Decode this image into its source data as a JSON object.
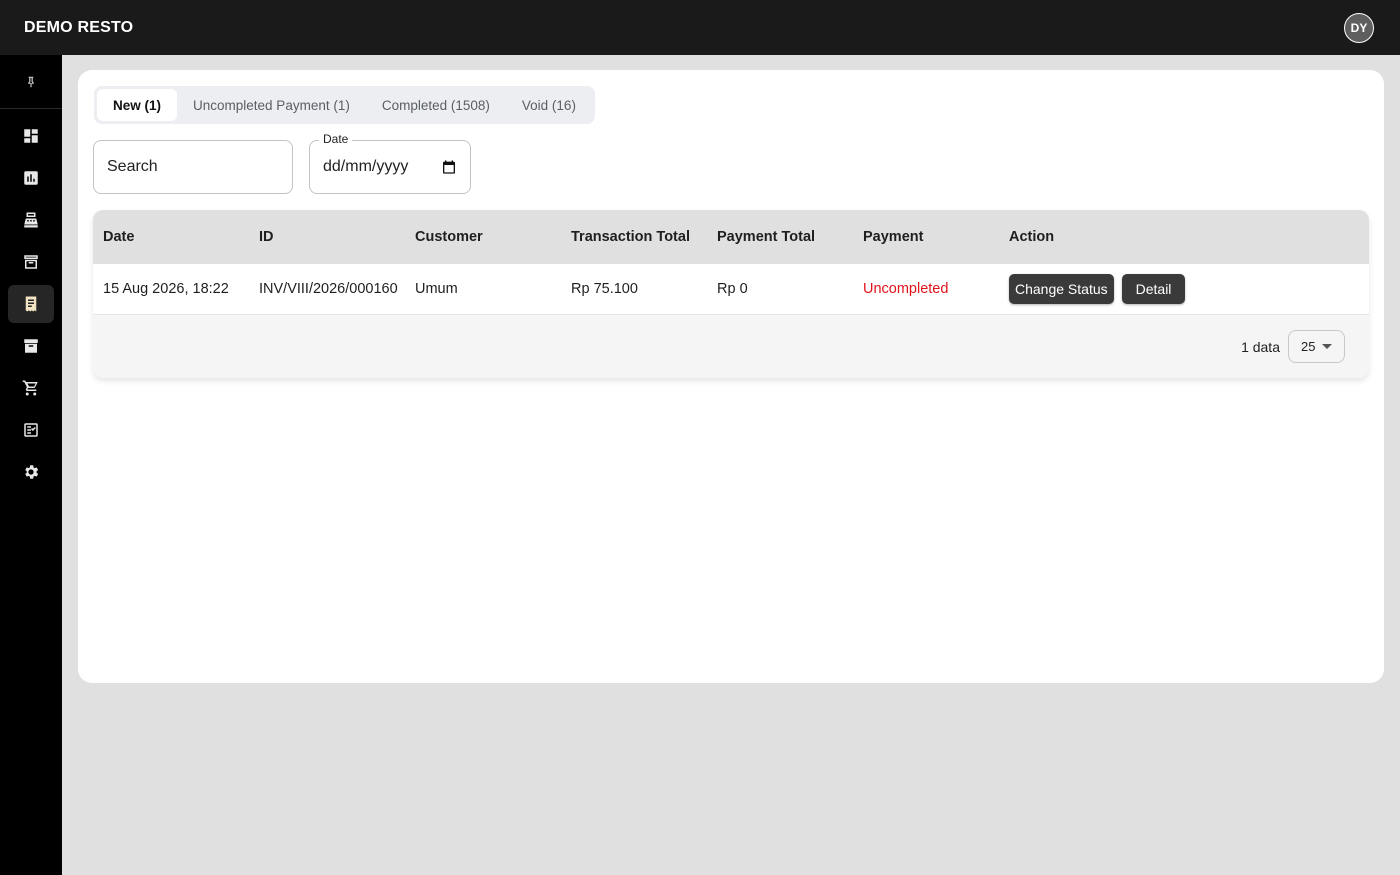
{
  "app": {
    "brand": "DEMO RESTO",
    "avatar_initials": "DY"
  },
  "sidebar": {
    "pin_icon": "pin-icon",
    "items": [
      {
        "icon": "dashboard-icon",
        "active": false
      },
      {
        "icon": "bar-chart-icon",
        "active": false
      },
      {
        "icon": "cash-register-icon",
        "active": false
      },
      {
        "icon": "archive-box-icon",
        "active": false
      },
      {
        "icon": "receipt-icon",
        "active": true
      },
      {
        "icon": "inventory-icon",
        "active": false
      },
      {
        "icon": "cart-icon",
        "active": false
      },
      {
        "icon": "checklist-icon",
        "active": false
      },
      {
        "icon": "settings-gear-icon",
        "active": false
      }
    ]
  },
  "tabs": [
    {
      "label": "New (1)",
      "active": true
    },
    {
      "label": "Uncompleted Payment (1)",
      "active": false
    },
    {
      "label": "Completed (1508)",
      "active": false
    },
    {
      "label": "Void (16)",
      "active": false
    }
  ],
  "filters": {
    "search_placeholder": "Search",
    "date_label": "Date",
    "date_value": "dd/mm/yyyy"
  },
  "table": {
    "columns": [
      "Date",
      "ID",
      "Customer",
      "Transaction Total",
      "Payment Total",
      "Payment",
      "Action"
    ],
    "rows": [
      {
        "date": "15 Aug 2026, 18:22",
        "id": "INV/VIII/2026/000160",
        "customer": "Umum",
        "transaction_total": "Rp 75.100",
        "payment_total": "Rp 0",
        "payment": "Uncompleted",
        "actions": [
          "Change Status",
          "Detail"
        ]
      }
    ],
    "footer": {
      "count_text": "1 data",
      "per_page": "25"
    }
  },
  "colors": {
    "uncompleted": "#e0141b",
    "active_nav": "#f2e3c2",
    "topbar": "#1a1a1a"
  }
}
